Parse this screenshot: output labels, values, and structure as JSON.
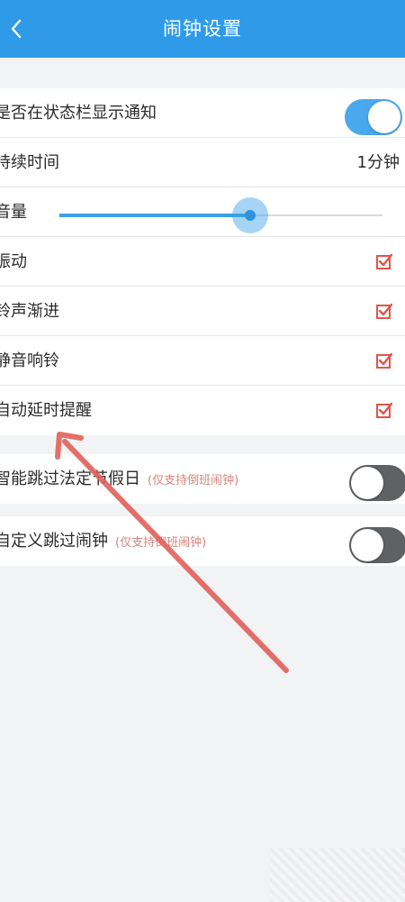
{
  "header": {
    "title": "闹钟设置",
    "back_icon": "chevron-left-icon"
  },
  "settings": {
    "status_bar": {
      "label": "是否在状态栏显示通知",
      "enabled": true
    },
    "duration": {
      "label": "持续时间",
      "value": "1分钟"
    },
    "volume": {
      "label": "音量",
      "level_percent": 59
    },
    "vibrate": {
      "label": "振动",
      "checked": true
    },
    "fade_in": {
      "label": "铃声渐进",
      "checked": true
    },
    "silent_ring": {
      "label": "静音响铃",
      "checked": true
    },
    "auto_snooze": {
      "label": "自动延时提醒",
      "checked": true
    }
  },
  "skip": {
    "holiday": {
      "label": "智能跳过法定节假日",
      "note": "(仅支持倒班闹钟)",
      "enabled": false
    },
    "custom": {
      "label": "自定义跳过闹钟",
      "note": "(仅支持倒班闹钟)",
      "enabled": false
    }
  },
  "colors": {
    "header": "#2f9be8",
    "accent": "#4aa8ef",
    "checkbox": "#e0554a",
    "annotation_arrow": "#e2605a"
  }
}
